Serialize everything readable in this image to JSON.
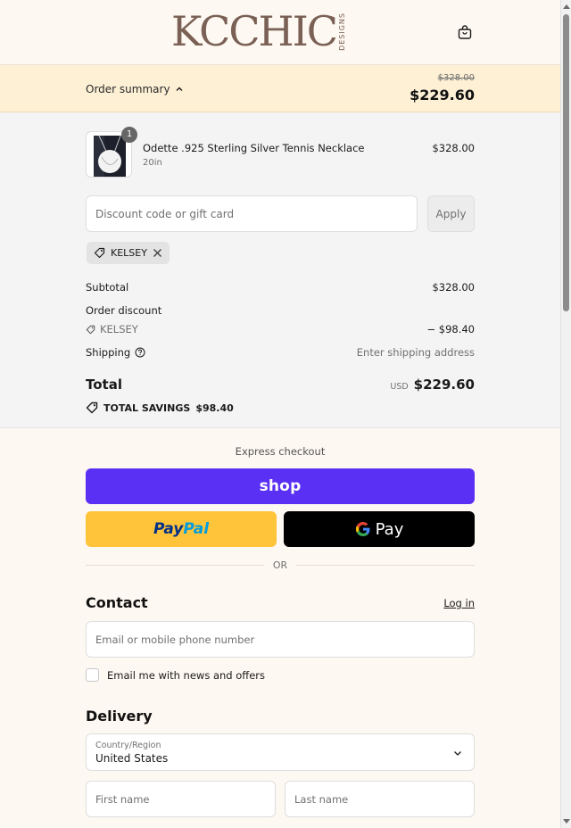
{
  "header": {
    "logo_text": "KCCHIC",
    "logo_subtext": "DESIGNS"
  },
  "summary_bar": {
    "toggle_label": "Order summary",
    "original_price": "$328.00",
    "current_price": "$229.60"
  },
  "product": {
    "quantity": "1",
    "name": "Odette .925 Sterling Silver Tennis Necklace",
    "variant": "20in",
    "price": "$328.00"
  },
  "discount": {
    "placeholder": "Discount code or gift card",
    "apply_label": "Apply",
    "applied_code": "KELSEY"
  },
  "totals": {
    "subtotal_label": "Subtotal",
    "subtotal_value": "$328.00",
    "order_discount_label": "Order discount",
    "discount_code": "KELSEY",
    "discount_value": "− $98.40",
    "shipping_label": "Shipping",
    "shipping_value": "Enter shipping address",
    "total_label": "Total",
    "currency": "USD",
    "total_value": "$229.60",
    "savings_label": "TOTAL SAVINGS",
    "savings_value": "$98.40"
  },
  "express": {
    "title": "Express checkout",
    "shop_label": "shop",
    "paypal_pay": "Pay",
    "paypal_pal": "Pal",
    "gpay_label": "Pay",
    "divider_label": "OR"
  },
  "contact": {
    "title": "Contact",
    "login_label": "Log in",
    "email_placeholder": "Email or mobile phone number",
    "newsletter_label": "Email me with news and offers"
  },
  "delivery": {
    "title": "Delivery",
    "country_label": "Country/Region",
    "country_value": "United States",
    "first_name_placeholder": "First name",
    "last_name_placeholder": "Last name"
  },
  "colors": {
    "shop_pay": "#5a31f4",
    "paypal": "#ffc439",
    "gpay": "#000000",
    "summary_bar": "#fdf0d5",
    "page_bg": "#fdf8f1"
  },
  "icons": {
    "bag": "shopping-bag-icon",
    "tag": "tag-icon",
    "close": "close-icon",
    "help": "question-circle-icon",
    "chevron_up": "chevron-up-icon",
    "chevron_down": "chevron-down-icon"
  }
}
